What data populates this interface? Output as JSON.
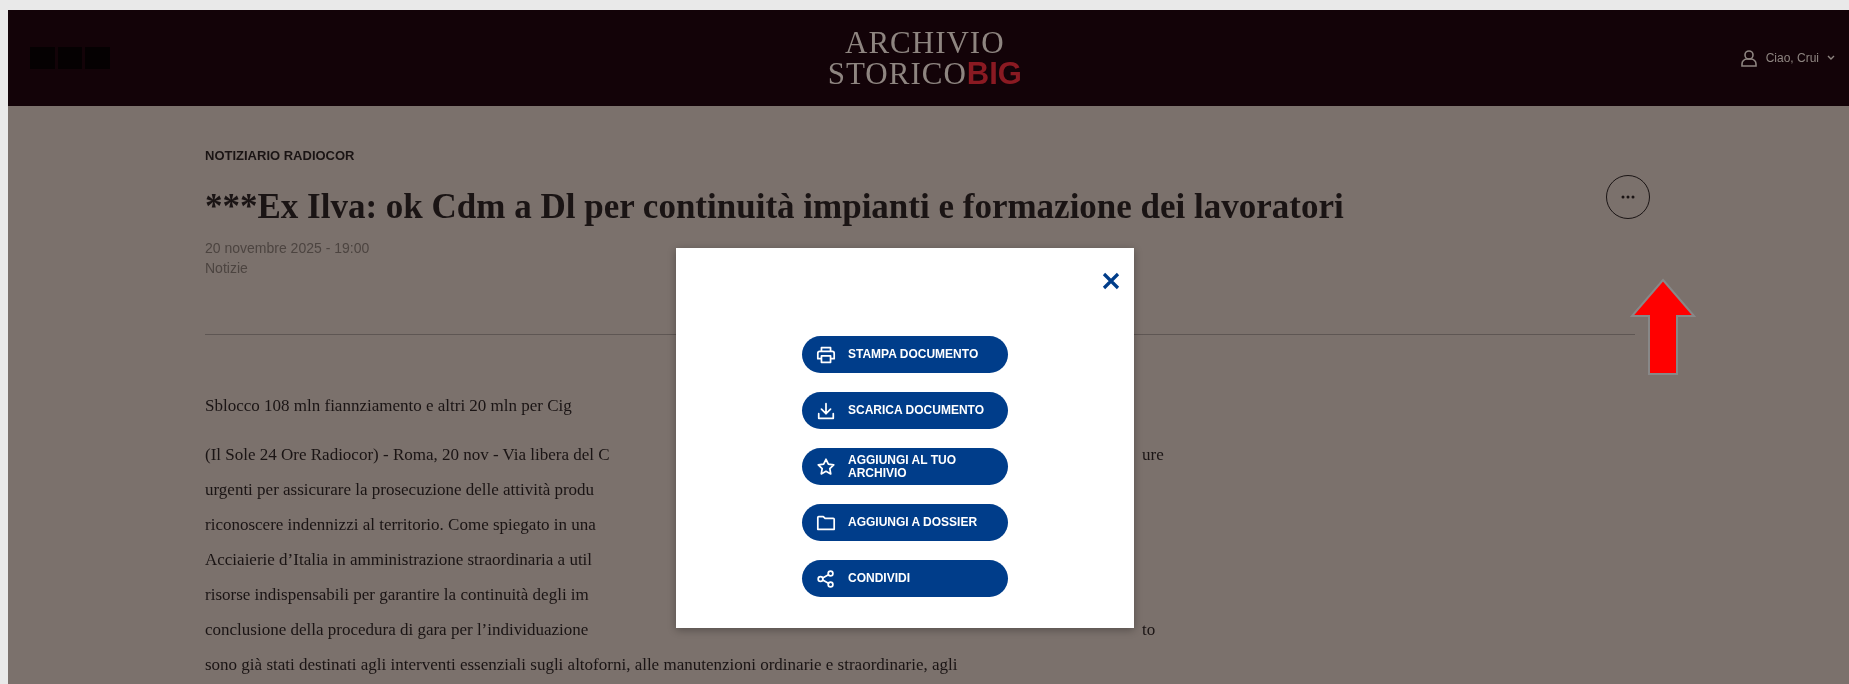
{
  "header": {
    "logo": {
      "line1": "ARCHIVIO",
      "line2": "STORICO",
      "line2_accent": "BIG"
    },
    "user_greeting": "Ciao, Crui"
  },
  "article": {
    "section": "NOTIZIARIO RADIOCOR",
    "title": "***Ex Ilva: ok Cdm a Dl per continuità impianti e formazione dei lavoratori",
    "date": "20 novembre 2025 - 19:00",
    "category": "Notizie",
    "subtitle": "Sblocco 108 mln fiannziamento e altri 20 mln per Cig",
    "lines": [
      {
        "kind": "split",
        "left": "(Il Sole 24 Ore Radiocor) - Roma, 20 nov - Via libera del C",
        "right": "ure"
      },
      {
        "kind": "split",
        "left": "urgenti per assicurare la prosecuzione delle attività produ"
      },
      {
        "kind": "split",
        "left": "riconoscere indennizzi al territorio. Come spiegato in una"
      },
      {
        "kind": "split",
        "left": "Acciaierie d’Italia in amministrazione straordinaria a util"
      },
      {
        "kind": "split",
        "left": "risorse indispensabili per garantire la continuità degli im"
      },
      {
        "kind": "split",
        "left": "conclusione della procedura di gara per l’individuazione",
        "right": "to"
      },
      {
        "kind": "full",
        "left": "sono già stati destinati agli interventi essenziali sugli altoforni, alle manutenzioni ordinarie e straordinarie, agli"
      }
    ]
  },
  "modal": {
    "actions": [
      {
        "kind": "print",
        "label": "STAMPA DOCUMENTO"
      },
      {
        "kind": "download",
        "label": "SCARICA DOCUMENTO"
      },
      {
        "kind": "star",
        "label": "AGGIUNGI AL TUO ARCHIVIO"
      },
      {
        "kind": "folder",
        "label": "AGGIUNGI A DOSSIER"
      },
      {
        "kind": "share",
        "label": "CONDIVIDI"
      }
    ]
  }
}
